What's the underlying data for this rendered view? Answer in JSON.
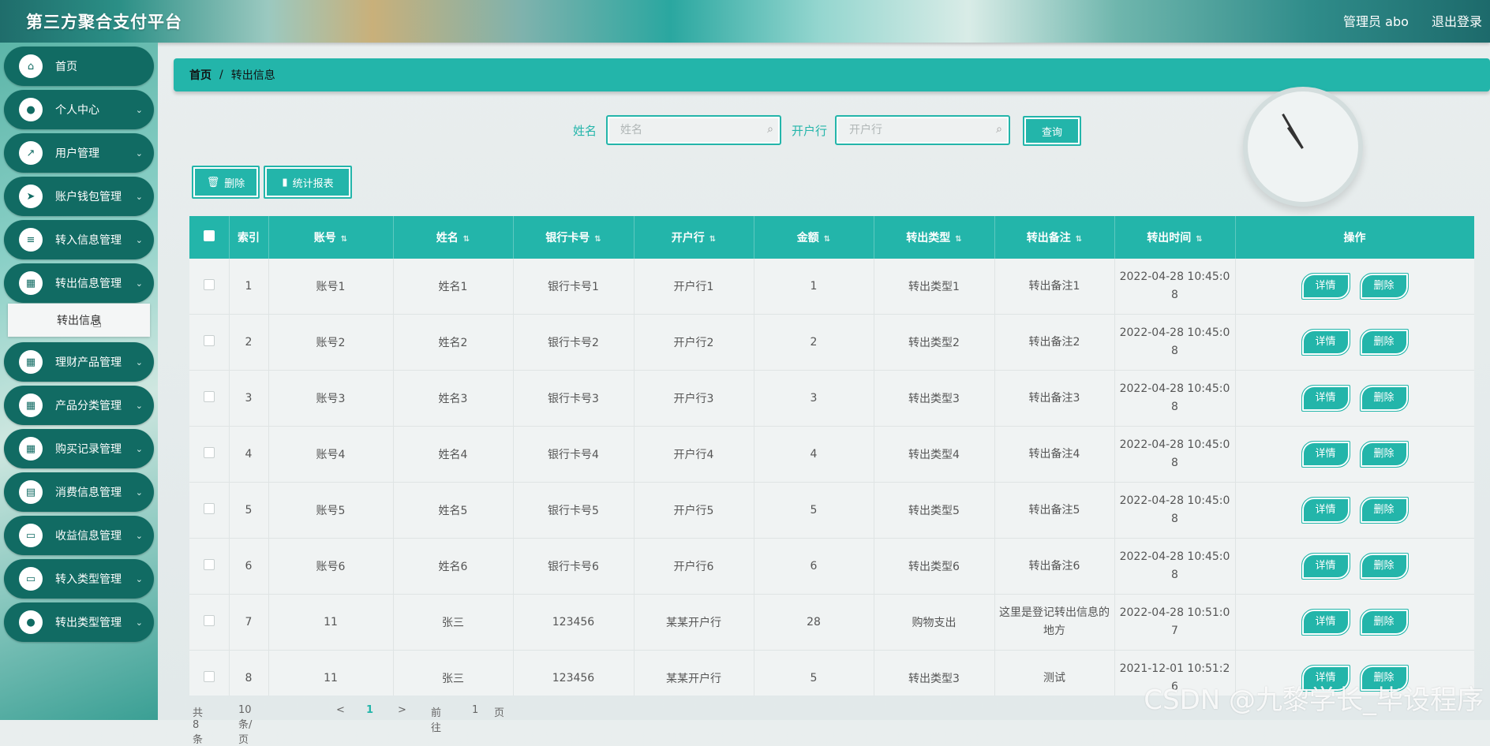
{
  "header": {
    "title": "第三方聚合支付平台",
    "user": "管理员 abo",
    "logout": "退出登录"
  },
  "sidebar": {
    "items": [
      {
        "label": "首页",
        "icon": "home-icon"
      },
      {
        "label": "个人中心",
        "icon": "user-icon"
      },
      {
        "label": "用户管理",
        "icon": "chart-icon"
      },
      {
        "label": "账户钱包管理",
        "icon": "send-icon"
      },
      {
        "label": "转入信息管理",
        "icon": "list-icon"
      },
      {
        "label": "转出信息管理",
        "icon": "grid-icon"
      },
      {
        "label": "理财产品管理",
        "icon": "grid-icon"
      },
      {
        "label": "产品分类管理",
        "icon": "grid-icon"
      },
      {
        "label": "购买记录管理",
        "icon": "grid-icon"
      },
      {
        "label": "消费信息管理",
        "icon": "clipboard-icon"
      },
      {
        "label": "收益信息管理",
        "icon": "monitor-icon"
      },
      {
        "label": "转入类型管理",
        "icon": "monitor-icon"
      },
      {
        "label": "转出类型管理",
        "icon": "user-icon"
      }
    ],
    "submenu_label": "转出信息"
  },
  "breadcrumb": {
    "home": "首页",
    "sep": "/",
    "current": "转出信息"
  },
  "search": {
    "name_label": "姓名",
    "name_placeholder": "姓名",
    "bank_label": "开户行",
    "bank_placeholder": "开户行",
    "query_label": "查询"
  },
  "actions": {
    "delete_label": "删除",
    "report_label": "统计报表"
  },
  "table": {
    "headers": [
      "索引",
      "账号",
      "姓名",
      "银行卡号",
      "开户行",
      "金额",
      "转出类型",
      "转出备注",
      "转出时间",
      "操作"
    ],
    "rows": [
      [
        "1",
        "账号1",
        "姓名1",
        "银行卡号1",
        "开户行1",
        "1",
        "转出类型1",
        "转出备注1",
        "2022-04-28 10:45:0",
        "8"
      ],
      [
        "2",
        "账号2",
        "姓名2",
        "银行卡号2",
        "开户行2",
        "2",
        "转出类型2",
        "转出备注2",
        "2022-04-28 10:45:0",
        "8"
      ],
      [
        "3",
        "账号3",
        "姓名3",
        "银行卡号3",
        "开户行3",
        "3",
        "转出类型3",
        "转出备注3",
        "2022-04-28 10:45:0",
        "8"
      ],
      [
        "4",
        "账号4",
        "姓名4",
        "银行卡号4",
        "开户行4",
        "4",
        "转出类型4",
        "转出备注4",
        "2022-04-28 10:45:0",
        "8"
      ],
      [
        "5",
        "账号5",
        "姓名5",
        "银行卡号5",
        "开户行5",
        "5",
        "转出类型5",
        "转出备注5",
        "2022-04-28 10:45:0",
        "8"
      ],
      [
        "6",
        "账号6",
        "姓名6",
        "银行卡号6",
        "开户行6",
        "6",
        "转出类型6",
        "转出备注6",
        "2022-04-28 10:45:0",
        "8"
      ],
      [
        "7",
        "11",
        "张三",
        "123456",
        "某某开户行",
        "28",
        "购物支出",
        "这里是登记转出信息的地方",
        "2022-04-28 10:51:0",
        "7"
      ],
      [
        "8",
        "11",
        "张三",
        "123456",
        "某某开户行",
        "5",
        "转出类型3",
        "测试",
        "2021-12-01 10:51:2",
        "6"
      ]
    ],
    "detail_label": "详情",
    "delete_label": "删除"
  },
  "pager": {
    "total": "共 8 条",
    "size": "10条/页",
    "prev": "<",
    "page": "1",
    "next": ">",
    "goto": "前往",
    "goto_page": "1",
    "goto_unit": "页"
  },
  "watermark": "CSDN @九黎学长_毕设程序",
  "colors": {
    "accent": "#23b5aa",
    "sidebar_item": "#116b63"
  }
}
